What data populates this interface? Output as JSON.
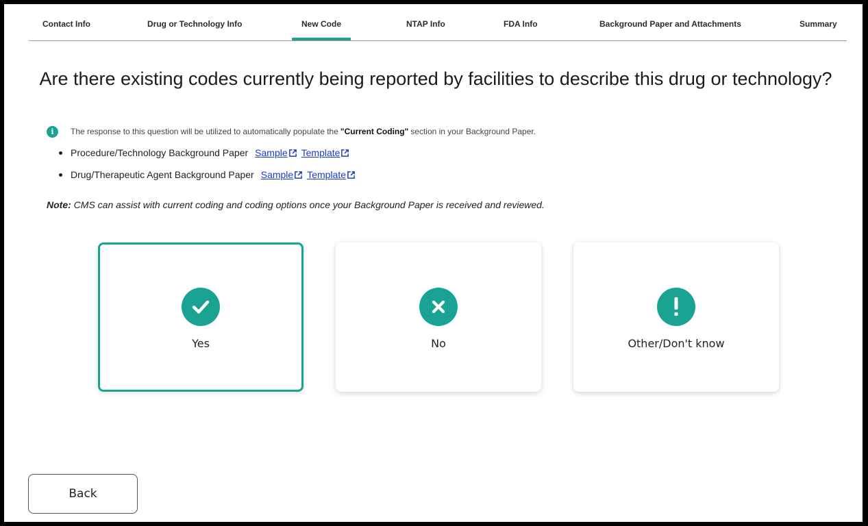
{
  "tabs": [
    {
      "label": "Contact Info"
    },
    {
      "label": "Drug or Technology Info"
    },
    {
      "label": "New Code"
    },
    {
      "label": "NTAP Info"
    },
    {
      "label": "FDA Info"
    },
    {
      "label": "Background Paper and Attachments"
    },
    {
      "label": "Summary"
    }
  ],
  "active_tab": "New Code",
  "accent_color": "#1aa392",
  "question": {
    "title": "Are there existing codes currently being reported by facilities to describe this drug or technology?"
  },
  "info": {
    "icon": "info-icon",
    "text_before": "The response to this question will be utilized to automatically populate the",
    "highlight": "\"Current Coding\"",
    "text_after": "section in your Background Paper."
  },
  "papers": [
    {
      "label": "Procedure/Technology Background Paper",
      "sample": "Sample",
      "template": "Template"
    },
    {
      "label": "Drug/Therapeutic Agent Background Paper",
      "sample": "Sample",
      "template": "Template"
    }
  ],
  "note": {
    "prefix": "Note:",
    "text": "CMS can assist with current coding and coding options once your Background Paper is received and reviewed."
  },
  "options": [
    {
      "label": "Yes",
      "icon": "check-icon",
      "selected": true
    },
    {
      "label": "No",
      "icon": "x-icon",
      "selected": false
    },
    {
      "label": "Other/Don't know",
      "icon": "exclamation-icon",
      "selected": false
    }
  ],
  "back_button": {
    "label": "Back"
  }
}
